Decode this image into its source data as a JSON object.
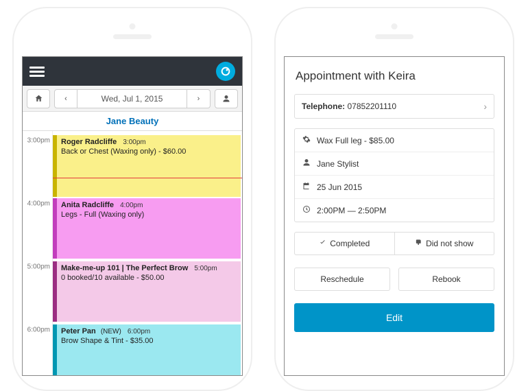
{
  "left": {
    "toolbar_date": "Wed, Jul 1, 2015",
    "staff": "Jane Beauty",
    "times": {
      "t1": "3:00pm",
      "t2": "4:00pm",
      "t3": "5:00pm",
      "t4": "6:00pm"
    },
    "slots": {
      "s1": {
        "name": "Roger Radcliffe",
        "time": "3:00pm",
        "desc": "Back or Chest (Waxing only) - $60.00"
      },
      "s2": {
        "name": "Anita Radcliffe",
        "time": "4:00pm",
        "desc": "Legs - Full (Waxing only)"
      },
      "s3": {
        "name": "Make-me-up 101 | The Perfect Brow",
        "time": "5:00pm",
        "desc": "0 booked/10 available - $50.00"
      },
      "s4": {
        "name": "Peter Pan",
        "tag": "(NEW)",
        "time": "6:00pm",
        "desc": "Brow Shape & Tint - $35.00"
      }
    }
  },
  "right": {
    "title": "Appointment with Keira",
    "tel_label": "Telephone:",
    "tel_value": "07852201110",
    "service": "Wax Full leg - $85.00",
    "stylist": "Jane Stylist",
    "date": "25 Jun 2015",
    "time": "2:00PM — 2:50PM",
    "completed": "Completed",
    "noshow": "Did not show",
    "reschedule": "Reschedule",
    "rebook": "Rebook",
    "edit": "Edit"
  }
}
